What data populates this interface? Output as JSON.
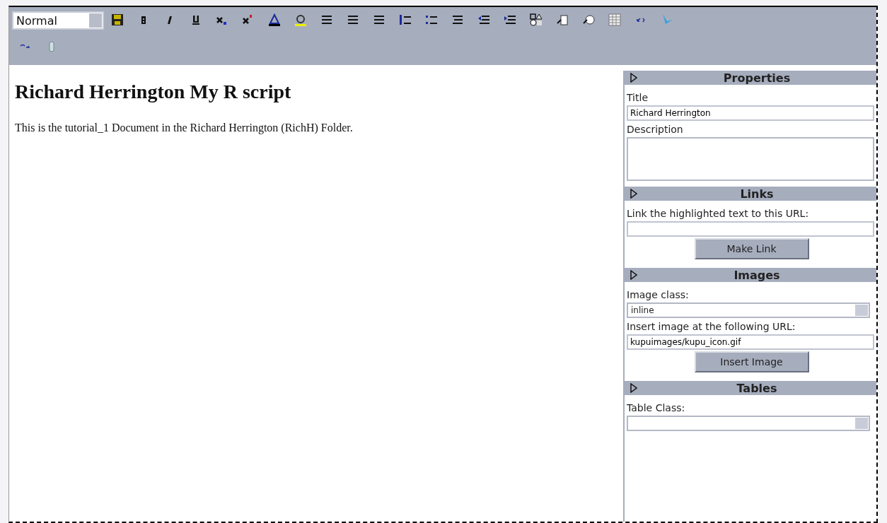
{
  "toolbar": {
    "style_select": {
      "value": "Normal"
    }
  },
  "document": {
    "heading": "Richard Herrington My R script",
    "paragraph": "This is the tutorial_1 Document in the Richard Herrington (RichH) Folder."
  },
  "sidebar": {
    "sections": [
      {
        "title": "Properties",
        "items": [
          {
            "kind": "label",
            "text": "Title"
          },
          {
            "kind": "input",
            "value": "Richard Herrington"
          },
          {
            "kind": "label",
            "text": "Description"
          },
          {
            "kind": "textarea"
          }
        ]
      },
      {
        "title": "Links",
        "items": [
          {
            "kind": "label",
            "text": "Link the highlighted text to this URL:"
          },
          {
            "kind": "input"
          },
          {
            "kind": "button",
            "text": "Make Link"
          }
        ]
      },
      {
        "title": "Images",
        "items": [
          {
            "kind": "label",
            "text": "Image class:"
          },
          {
            "kind": "select",
            "value": "inline"
          },
          {
            "kind": "label",
            "text": "Insert image at the following URL:"
          },
          {
            "kind": "input",
            "value": "kupuimages/kupu_icon.gif"
          },
          {
            "kind": "button",
            "text": "Insert Image"
          }
        ]
      },
      {
        "title": "Tables",
        "items": [
          {
            "kind": "label",
            "text": "Table Class:"
          },
          {
            "kind": "select"
          }
        ]
      }
    ]
  }
}
